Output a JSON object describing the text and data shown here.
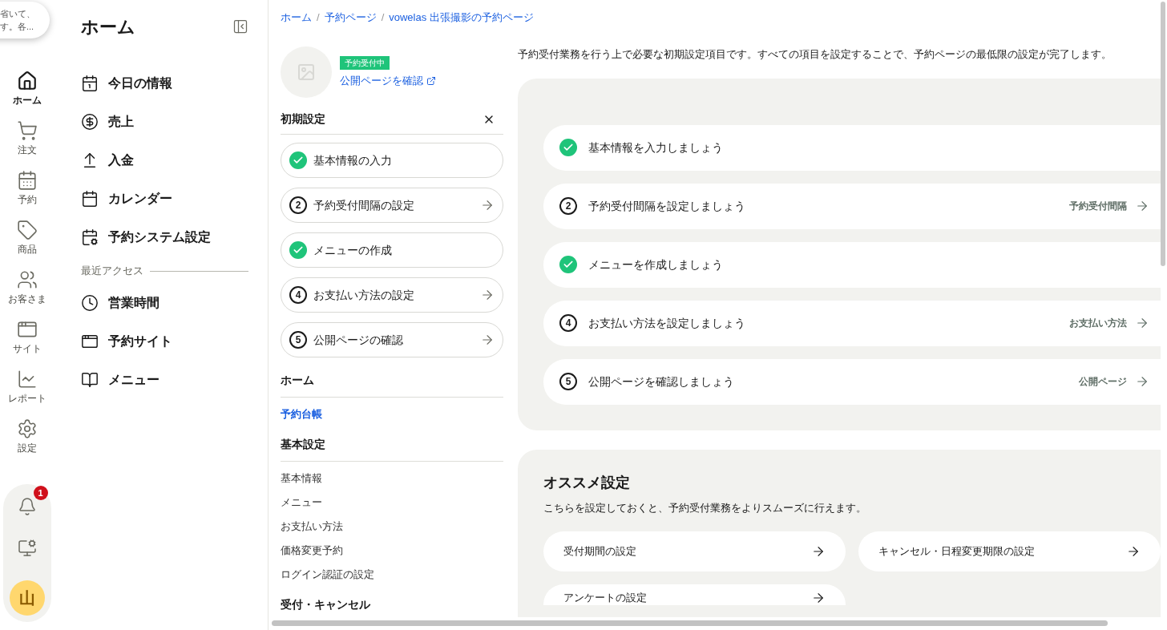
{
  "tooltip": {
    "lines": [
      "省いて、",
      "す。各..."
    ]
  },
  "rail": {
    "items": [
      {
        "label": "ホーム",
        "selected": true
      },
      {
        "label": "注文",
        "selected": false
      },
      {
        "label": "予約",
        "selected": false
      },
      {
        "label": "商品",
        "selected": false
      },
      {
        "label": "お客さま",
        "selected": false
      },
      {
        "label": "サイト",
        "selected": false
      },
      {
        "label": "レポート",
        "selected": false
      },
      {
        "label": "設定",
        "selected": false
      }
    ],
    "notification_badge": "1",
    "avatar": "山"
  },
  "nav": {
    "title": "ホーム",
    "items": [
      "今日の情報",
      "売上",
      "入金",
      "カレンダー",
      "予約システム設定"
    ],
    "recent_heading": "最近アクセス",
    "recent": [
      "営業時間",
      "予約サイト",
      "メニュー"
    ]
  },
  "breadcrumbs": {
    "separator": "/",
    "items": [
      "ホーム",
      "予約ページ",
      "vowelas 出張撮影の予約ページ"
    ]
  },
  "page": {
    "status_badge": "予約受付中",
    "public_link": "公開ページを確認"
  },
  "setup": {
    "title": "初期設定",
    "steps": [
      {
        "kind": "done",
        "label": "基本情報の入力"
      },
      {
        "kind": "todo",
        "number": "2",
        "label": "予約受付間隔の設定"
      },
      {
        "kind": "done",
        "label": "メニューの作成"
      },
      {
        "kind": "todo",
        "number": "4",
        "label": "お支払い方法の設定"
      },
      {
        "kind": "todo",
        "number": "5",
        "label": "公開ページの確認"
      }
    ]
  },
  "sections": [
    {
      "title": "ホーム",
      "links": [
        {
          "label": "予約台帳",
          "selected": true
        }
      ]
    },
    {
      "title": "基本設定",
      "links": [
        {
          "label": "基本情報",
          "selected": false
        },
        {
          "label": "メニュー",
          "selected": false
        },
        {
          "label": "お支払い方法",
          "selected": false
        },
        {
          "label": "価格変更予約",
          "selected": false
        },
        {
          "label": "ログイン認証の設定",
          "selected": false
        }
      ]
    },
    {
      "title": "受付・キャンセル"
    }
  ],
  "intro": "予約受付業務を行う上で必要な初期設定項目です。すべての項目を設定することで、予約ページの最低限の設定が完了します。",
  "tasks": [
    {
      "kind": "done",
      "label": "基本情報を入力しましょう"
    },
    {
      "kind": "todo",
      "number": "2",
      "label": "予約受付間隔を設定しましょう",
      "link": "予約受付間隔"
    },
    {
      "kind": "done",
      "label": "メニューを作成しましょう"
    },
    {
      "kind": "todo",
      "number": "4",
      "label": "お支払い方法を設定しましょう",
      "link": "お支払い方法"
    },
    {
      "kind": "todo",
      "number": "5",
      "label": "公開ページを確認しましょう",
      "link": "公開ページ"
    }
  ],
  "recommended": {
    "title": "オススメ設定",
    "description": "こちらを設定しておくと、予約受付業務をよりスムーズに行えます。",
    "items": [
      "受付期間の設定",
      "キャンセル・日程変更期限の設定",
      "アンケートの設定"
    ]
  }
}
